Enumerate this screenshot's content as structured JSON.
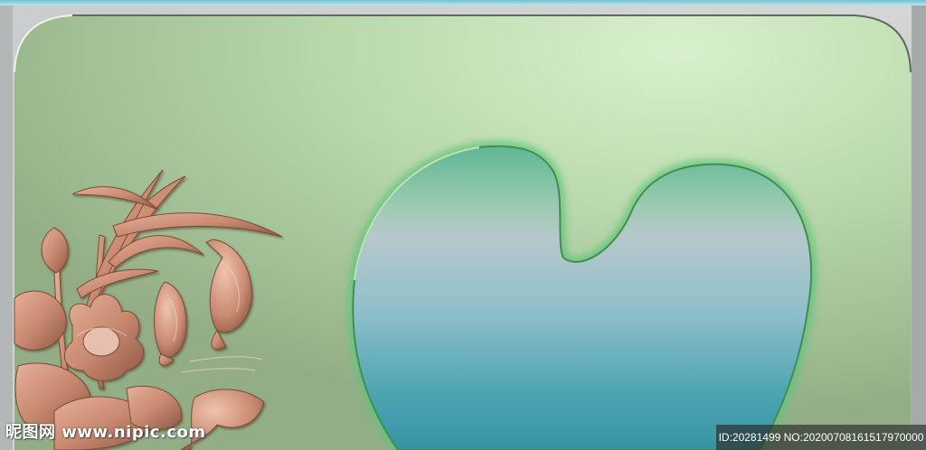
{
  "watermark": {
    "site": "昵图网 www.nipic.com",
    "id_text": "ID:20281499 NO:20200708161517970000"
  }
}
